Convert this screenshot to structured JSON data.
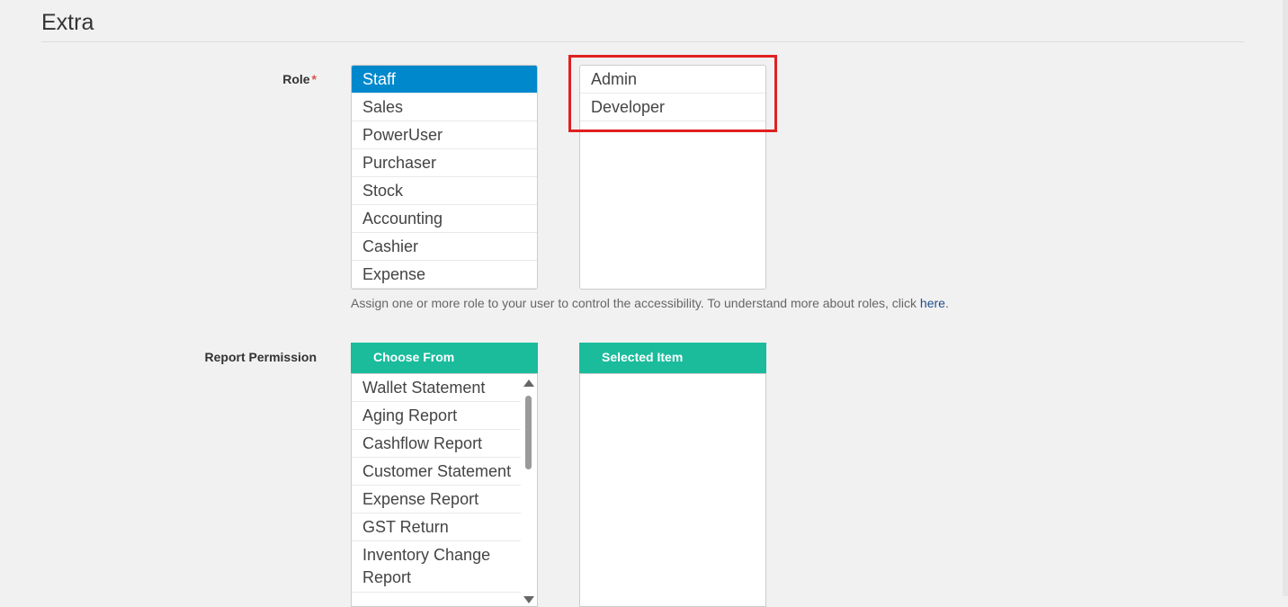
{
  "section": {
    "title": "Extra"
  },
  "role": {
    "label": "Role",
    "required_mark": "*",
    "available": [
      "Staff",
      "Sales",
      "PowerUser",
      "Purchaser",
      "Stock",
      "Accounting",
      "Cashier",
      "Expense"
    ],
    "selected_available": "Staff",
    "assigned": [
      "Admin",
      "Developer"
    ],
    "help_text": "Assign one or more role to your user to control the accessibility. To understand more about roles, click ",
    "help_link": "here",
    "help_suffix": "."
  },
  "report_permission": {
    "label": "Report Permission",
    "choose_header": "Choose From",
    "selected_header": "Selected Item",
    "available": [
      "Wallet Statement",
      "Aging Report",
      "Cashflow Report",
      "Customer Statement",
      "Expense Report",
      "GST Return",
      "Inventory Change Report"
    ],
    "selected": []
  },
  "annotation": {
    "highlight_color": "#e02020"
  },
  "colors": {
    "selection": "#0088cc",
    "panel_header": "#1abc9c",
    "required": "#d9534f"
  },
  "icons": {
    "scroll_up": "triangle-up",
    "scroll_down": "triangle-down"
  }
}
